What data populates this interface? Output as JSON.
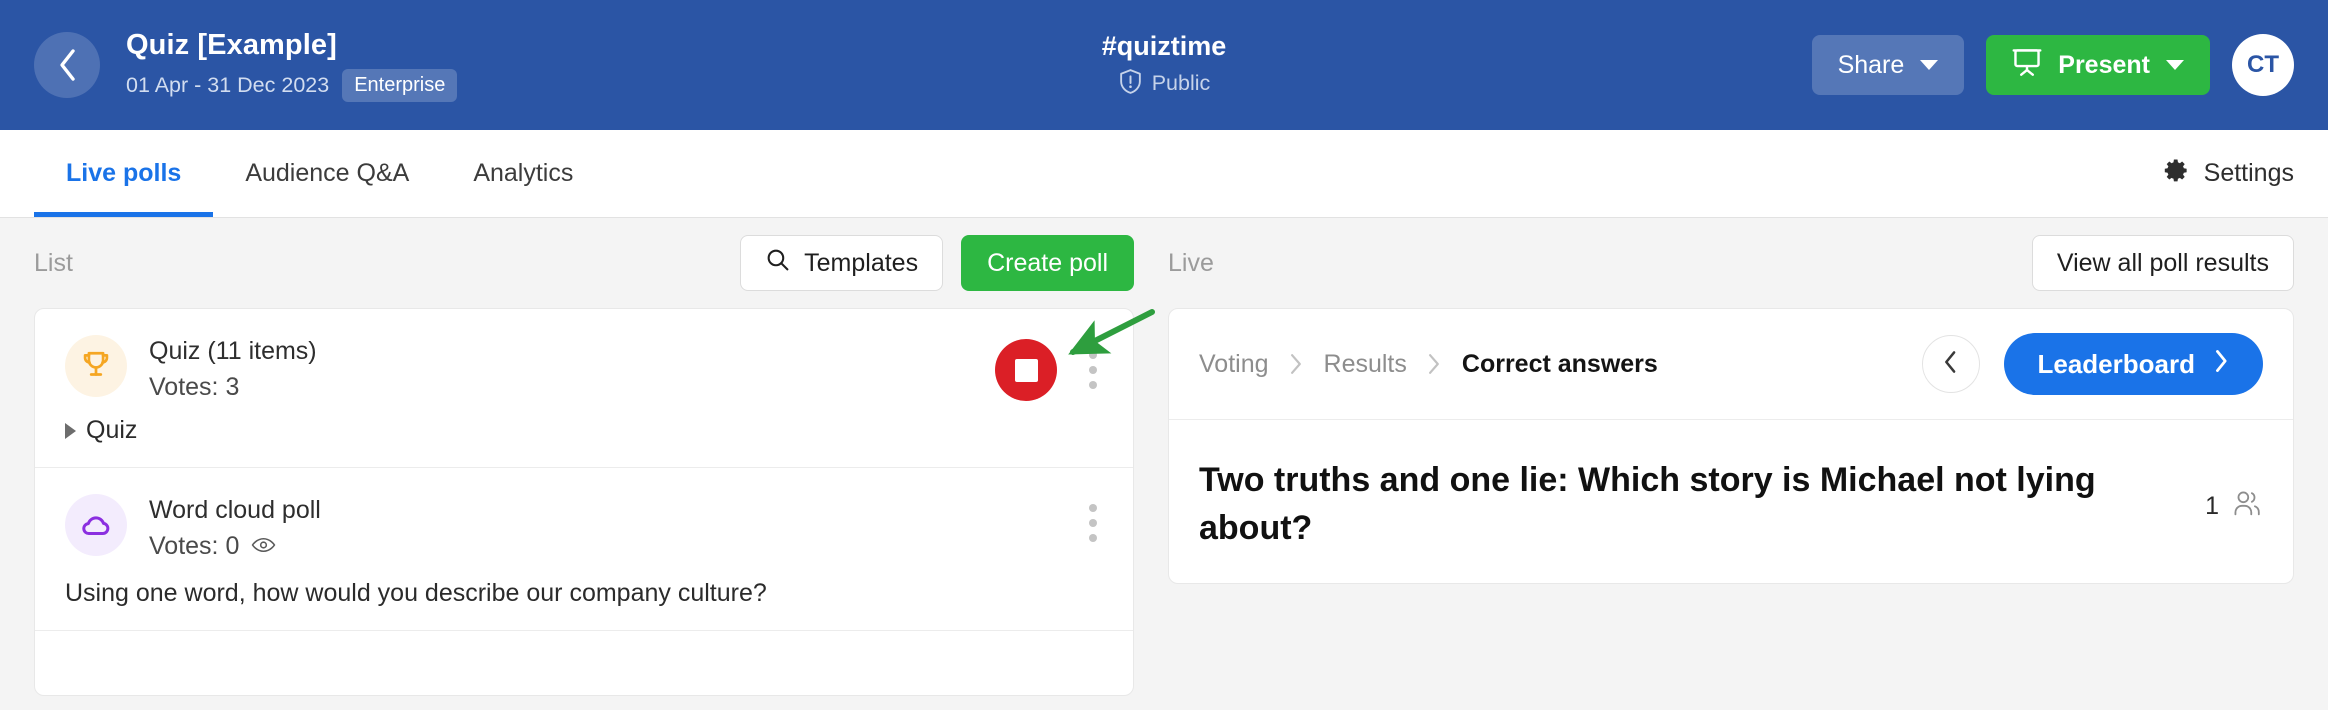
{
  "header": {
    "back_icon": "chevron-left-icon",
    "event_title": "Quiz [Example]",
    "event_dates": "01 Apr - 31 Dec 2023",
    "plan_badge": "Enterprise",
    "event_code": "#quiztime",
    "visibility_icon": "shield-alert-icon",
    "visibility": "Public",
    "share_label": "Share",
    "present_icon": "presentation-icon",
    "present_label": "Present",
    "avatar_initials": "CT",
    "bg_color": "#2b55a5",
    "present_color": "#2db742"
  },
  "tabs": {
    "items": [
      {
        "label": "Live polls",
        "active": true
      },
      {
        "label": "Audience Q&A",
        "active": false
      },
      {
        "label": "Analytics",
        "active": false
      }
    ],
    "settings_icon": "gear-icon",
    "settings_label": "Settings",
    "active_color": "#1a73e8"
  },
  "left_panel": {
    "label": "List",
    "templates_icon": "search-icon",
    "templates_label": "Templates",
    "create_poll_label": "Create poll",
    "polls": [
      {
        "icon": "trophy-icon",
        "icon_color": "#f5a623",
        "title": "Quiz (11 items)",
        "votes": "Votes: 3",
        "has_eye": false,
        "sub_label": "Quiz",
        "question": "",
        "stop_button": true,
        "stop_color": "#db1f26"
      },
      {
        "icon": "cloud-icon",
        "icon_color": "#8b2fe0",
        "title": "Word cloud poll",
        "votes": "Votes: 0",
        "has_eye": true,
        "sub_label": "",
        "question": "Using one word, how would you describe our company culture?",
        "stop_button": false,
        "stop_color": ""
      }
    ]
  },
  "right_panel": {
    "label": "Live",
    "view_all_label": "View all poll results",
    "breadcrumb": [
      {
        "label": "Voting",
        "current": false
      },
      {
        "label": "Results",
        "current": false
      },
      {
        "label": "Correct answers",
        "current": true
      }
    ],
    "back_icon": "chevron-left-icon",
    "leaderboard_label": "Leaderboard",
    "leaderboard_icon": "chevron-right-icon",
    "leaderboard_color": "#1a73e8",
    "question": "Two truths and one lie: Which story is Michael not lying about?",
    "participants_count": "1",
    "participants_icon": "people-icon"
  },
  "annotation": {
    "type": "arrow",
    "color": "#2e9e3e",
    "points_to": "stop-poll-button"
  }
}
